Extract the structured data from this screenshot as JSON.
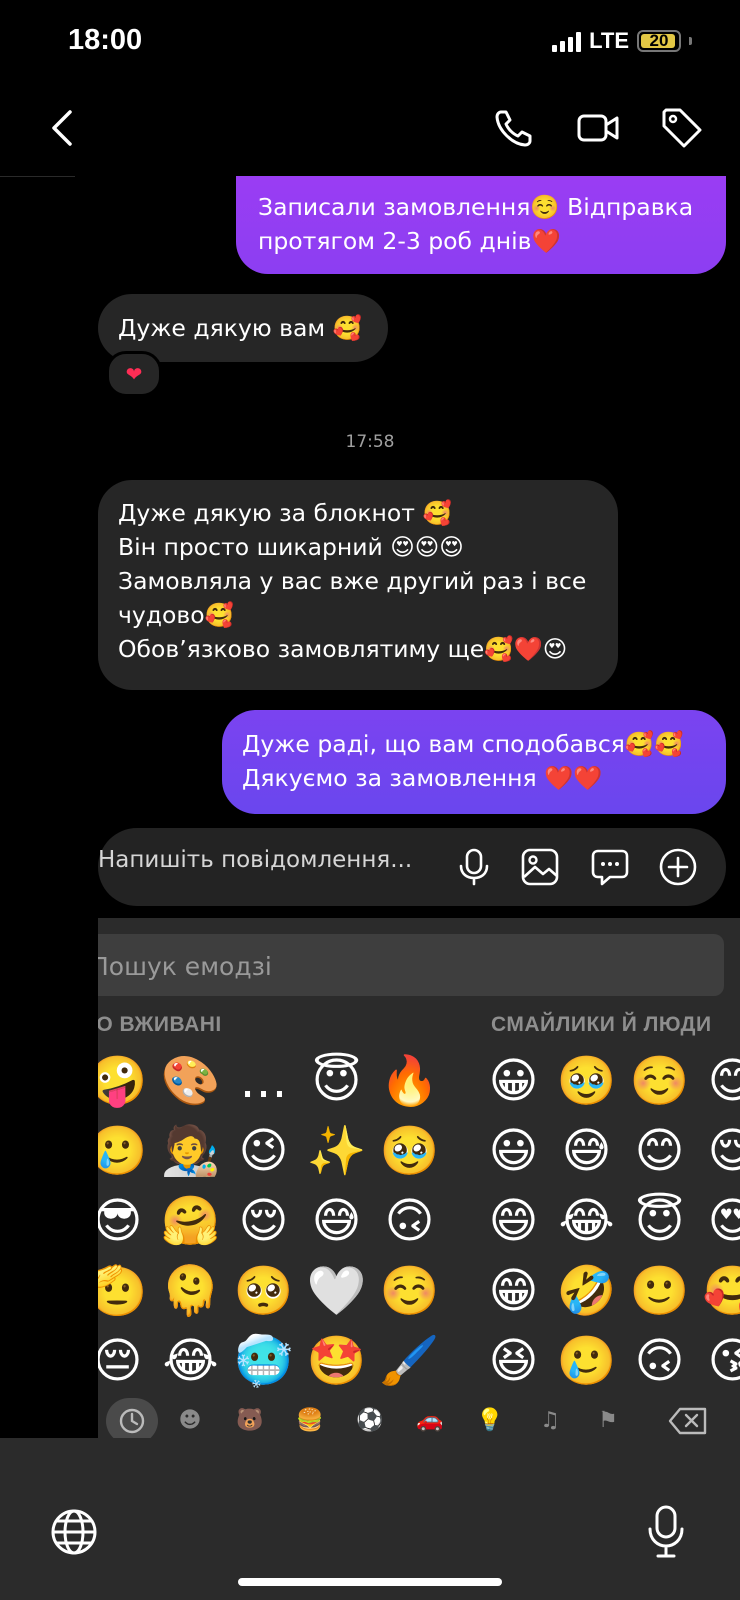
{
  "status_bar": {
    "time": "18:00",
    "network": "LTE",
    "battery_level": "20",
    "battery_color": "#e3c845"
  },
  "header": {
    "icons": [
      "back-chevron-icon",
      "phone-icon",
      "video-call-icon",
      "tag-icon"
    ]
  },
  "messages": [
    {
      "direction": "outgoing",
      "text": "Записали замовлення☺️ Відправка\nпротягом 2-3 роб днів❤️"
    },
    {
      "direction": "incoming",
      "text": "Дуже дякую вам 🥰",
      "reaction": "❤"
    },
    {
      "direction": "incoming",
      "text": "Дуже дякую за блокнот 🥰\nВін просто шикарний 😍😍😍\nЗамовляла у вас вже другий раз і все\nчудово🥰\nОбов’язково замовлятиму ще🥰❤️😍"
    },
    {
      "direction": "outgoing",
      "text": "Дуже раді, що вам сподобався🥰🥰\nДякуємо за замовлення ❤️❤️"
    }
  ],
  "timestamp": "17:58",
  "composer": {
    "placeholder": "Напишіть повідомлення..."
  },
  "keyboard": {
    "search_placeholder": "Пошук емодзі",
    "section_recent": "ЧАСТО ВЖИВАНІ",
    "section_smileys": "СМАЙЛИКИ Й ЛЮДИ",
    "recent_emojis": [
      "🤪",
      "🎨",
      "…",
      "😇",
      "🔥",
      "🥲",
      "🧑‍🎨",
      "😉",
      "✨",
      "🥹",
      "😎",
      "🤗",
      "😌",
      "😅",
      "🙃",
      "🫡",
      "🫠",
      "🥺",
      "🤍",
      "☺️",
      "😔",
      "😂",
      "🥶",
      "🤩",
      "🖌️"
    ],
    "smiley_emojis": [
      "😀",
      "🥹",
      "☺️",
      "😊",
      "😃",
      "😅",
      "😊",
      "😌",
      "😄",
      "😂",
      "😇",
      "😍",
      "😁",
      "🤣",
      "🙂",
      "🥰",
      "😆",
      "🥲",
      "🙃",
      "😘"
    ],
    "categories": [
      "clock-icon",
      "smiley-icon",
      "bear-icon",
      "burger-icon",
      "ball-icon",
      "car-icon",
      "bulb-icon",
      "symbols-icon",
      "flag-icon",
      "backspace-icon"
    ]
  },
  "colors": {
    "outgoing_top": "#9b3cf2",
    "outgoing_bottom": "#6b45ee",
    "incoming": "#262626",
    "background": "#000000"
  }
}
